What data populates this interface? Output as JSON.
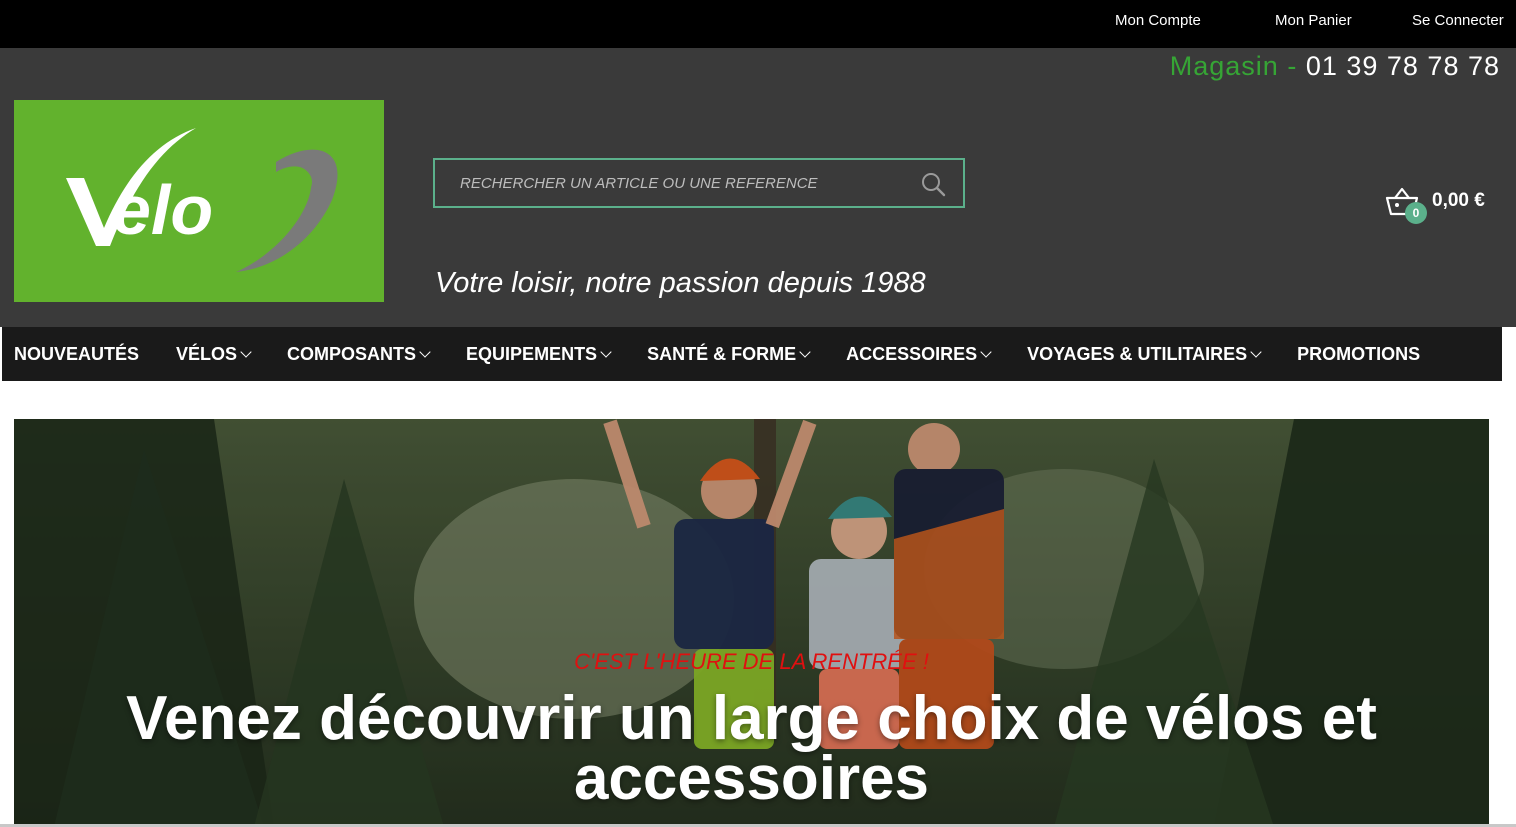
{
  "topbar": {
    "account_label": "Mon Compte",
    "cart_label": "Mon Panier",
    "login_label": "Se Connecter"
  },
  "header": {
    "store_label": "Magasin",
    "store_separator": " - ",
    "phone": "01 39 78 78 78",
    "logo_text": "Velo9",
    "tagline": "Votre loisir, notre passion depuis 1988"
  },
  "search": {
    "placeholder": "RECHERCHER UN ARTICLE OU UNE REFERENCE",
    "value": "",
    "icon": "search-icon"
  },
  "minicart": {
    "icon": "basket-icon",
    "count": "0",
    "total": "0,00 €"
  },
  "nav": {
    "items": [
      {
        "label": "NOUVEAUTÉS",
        "dropdown": false
      },
      {
        "label": "VÉLOS",
        "dropdown": true
      },
      {
        "label": "COMPOSANTS",
        "dropdown": true
      },
      {
        "label": "EQUIPEMENTS",
        "dropdown": true
      },
      {
        "label": "SANTÉ & FORME",
        "dropdown": true
      },
      {
        "label": "ACCESSOIRES",
        "dropdown": true
      },
      {
        "label": "VOYAGES & UTILITAIRES",
        "dropdown": true
      },
      {
        "label": "PROMOTIONS",
        "dropdown": false
      }
    ]
  },
  "hero": {
    "kicker": "C'EST L'HEURE DE LA RENTRÉE !",
    "headline": "Venez découvrir un large choix de vélos et accessoires"
  },
  "colors": {
    "brand_green": "#62b22d",
    "accent_teal": "#5bb08b",
    "header_bg": "#3a3a3a",
    "nav_bg": "#1a1a1a",
    "kicker_red": "#e01010"
  }
}
